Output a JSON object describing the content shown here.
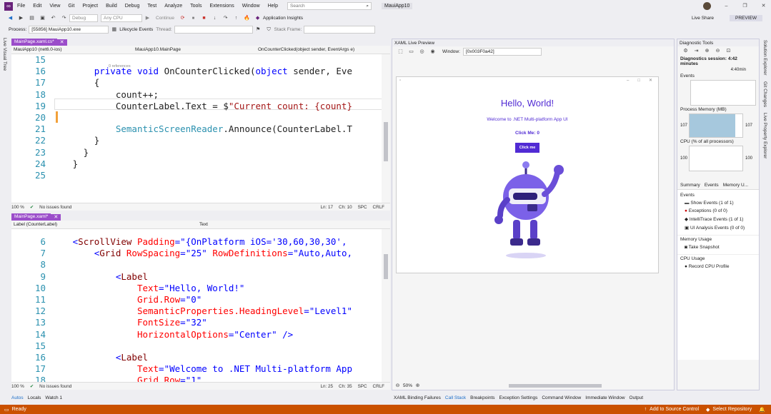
{
  "menu": [
    "File",
    "Edit",
    "View",
    "Git",
    "Project",
    "Build",
    "Debug",
    "Test",
    "Analyze",
    "Tools",
    "Extensions",
    "Window",
    "Help"
  ],
  "search": {
    "placeholder": "Search"
  },
  "app_title": "MauiApp10",
  "toolbar": {
    "config": "Debug",
    "platform": "Any CPU",
    "continue_label": "Continue",
    "app_insights": "Application Insights",
    "live_share": "Live Share",
    "preview": "PREVIEW"
  },
  "procbar": {
    "process_label": "Process:",
    "process_value": "[55856] MauiApp10.exe",
    "lifecycle": "Lifecycle Events",
    "thread_label": "Thread:",
    "stack_frame": "Stack Frame:"
  },
  "leftrail": {
    "label": "Live Visual Tree"
  },
  "rightrail": {
    "items": [
      "Solution Explorer",
      "Git Changes",
      "Live Property Explorer"
    ]
  },
  "editor1": {
    "tab": "MainPage.xaml.cs*",
    "nav": [
      "MauiApp10 (net6.0-ios)",
      "MauiApp10.MainPage",
      "OnCounterClicked(object sender, EventArgs e)"
    ],
    "refs": "0 references",
    "lines": [
      {
        "n": "15",
        "html": ""
      },
      {
        "n": "16",
        "html": "    <span class=\"kw\">private void</span> OnCounterClicked(<span class=\"kw\">object</span> sender, Eve"
      },
      {
        "n": "17",
        "html": "    {"
      },
      {
        "n": "18",
        "html": "        count++;"
      },
      {
        "n": "19",
        "html": "        CounterLabel.Text = $<span class=\"str\">\"Current count: {count}</span>"
      },
      {
        "n": "20",
        "html": ""
      },
      {
        "n": "21",
        "html": "        <span class=\"ty\">SemanticScreenReader</span>.Announce(CounterLabel.T"
      },
      {
        "n": "22",
        "html": "    }"
      },
      {
        "n": "23",
        "html": "  }"
      },
      {
        "n": "24",
        "html": "}"
      },
      {
        "n": "25",
        "html": ""
      }
    ],
    "status": {
      "zoom": "100 %",
      "issues": "No issues found",
      "ln": "Ln: 17",
      "ch": "Ch: 10",
      "spc": "SPC",
      "crlf": "CRLF"
    }
  },
  "editor2": {
    "tab": "MainPage.xaml*",
    "nav": [
      "Label (CounterLabel)",
      "Text"
    ],
    "lines": [
      {
        "n": "6",
        "html": "<span class=\"kw\">&lt;</span><span class=\"tag\">ScrollView</span> <span class=\"attr\">Padding</span><span class=\"kw\">=\"{OnPlatform iOS='30,60,30,30',</span>"
      },
      {
        "n": "7",
        "html": "    <span class=\"kw\">&lt;</span><span class=\"tag\">Grid</span> <span class=\"attr\">RowSpacing</span><span class=\"kw\">=\"25\"</span> <span class=\"attr\">RowDefinitions</span><span class=\"kw\">=\"Auto,Auto,</span>"
      },
      {
        "n": "8",
        "html": ""
      },
      {
        "n": "9",
        "html": "        <span class=\"kw\">&lt;</span><span class=\"tag\">Label</span>"
      },
      {
        "n": "10",
        "html": "            <span class=\"attr\">Text</span><span class=\"kw\">=\"Hello, World!\"</span>"
      },
      {
        "n": "11",
        "html": "            <span class=\"attr\">Grid.Row</span><span class=\"kw\">=\"0\"</span>"
      },
      {
        "n": "12",
        "html": "            <span class=\"attr\">SemanticProperties.HeadingLevel</span><span class=\"kw\">=\"Level1\"</span>"
      },
      {
        "n": "13",
        "html": "            <span class=\"attr\">FontSize</span><span class=\"kw\">=\"32\"</span>"
      },
      {
        "n": "14",
        "html": "            <span class=\"attr\">HorizontalOptions</span><span class=\"kw\">=\"Center\" /&gt;</span>"
      },
      {
        "n": "15",
        "html": ""
      },
      {
        "n": "16",
        "html": "        <span class=\"kw\">&lt;</span><span class=\"tag\">Label</span>"
      },
      {
        "n": "17",
        "html": "            <span class=\"attr\">Text</span><span class=\"kw\">=\"Welcome to .NET Multi-platform App</span>"
      },
      {
        "n": "18",
        "html": "            <span class=\"attr\">Grid.Row</span><span class=\"kw\">=\"1\"</span>"
      }
    ],
    "status": {
      "zoom": "100 %",
      "issues": "No issues found",
      "ln": "Ln: 25",
      "ch": "Ch: 35",
      "spc": "SPC",
      "crlf": "CRLF"
    }
  },
  "preview": {
    "title": "XAML Live Preview",
    "window_label": "Window:",
    "window_value": "[0x003F0a42]",
    "hello": "Hello, World!",
    "welcome": "Welcome to .NET Multi-platform App UI",
    "clickme": "Click Me: 0",
    "button": "Click me",
    "zoom": "50%"
  },
  "diag": {
    "title": "Diagnostic Tools",
    "session": "Diagnostics session: 4:42 minutes",
    "time": "4:40min",
    "events": "Events",
    "memory": "Process Memory (MB)",
    "mem_max": "107",
    "mem_min": "0",
    "cpu": "CPU (% of all processors)",
    "cpu_max": "100",
    "cpu_min": "0",
    "tabs": [
      "Summary",
      "Events",
      "Memory U..."
    ],
    "events_hdr": "Events",
    "events_items": [
      "Show Events (1 of 1)",
      "Exceptions (0 of 0)",
      "IntelliTrace Events (1 of 1)",
      "UI Analysis Events (0 of 0)"
    ],
    "memusage": "Memory Usage",
    "snapshot": "Take Snapshot",
    "cpuusage": "CPU Usage",
    "record": "Record CPU Profile"
  },
  "bottomtabs_left": [
    "Autos",
    "Locals",
    "Watch 1"
  ],
  "bottomtabs_right": [
    "XAML Binding Failures",
    "Call Stack",
    "Breakpoints",
    "Exception Settings",
    "Command Window",
    "Immediate Window",
    "Output"
  ],
  "statusbar": {
    "ready": "Ready",
    "source": "Add to Source Control",
    "repo": "Select Repository"
  },
  "colors": {
    "accent": "#512bd4",
    "vs_purple": "#68217a",
    "status_orange": "#ca5100",
    "tab_purple": "#9b4dca"
  }
}
